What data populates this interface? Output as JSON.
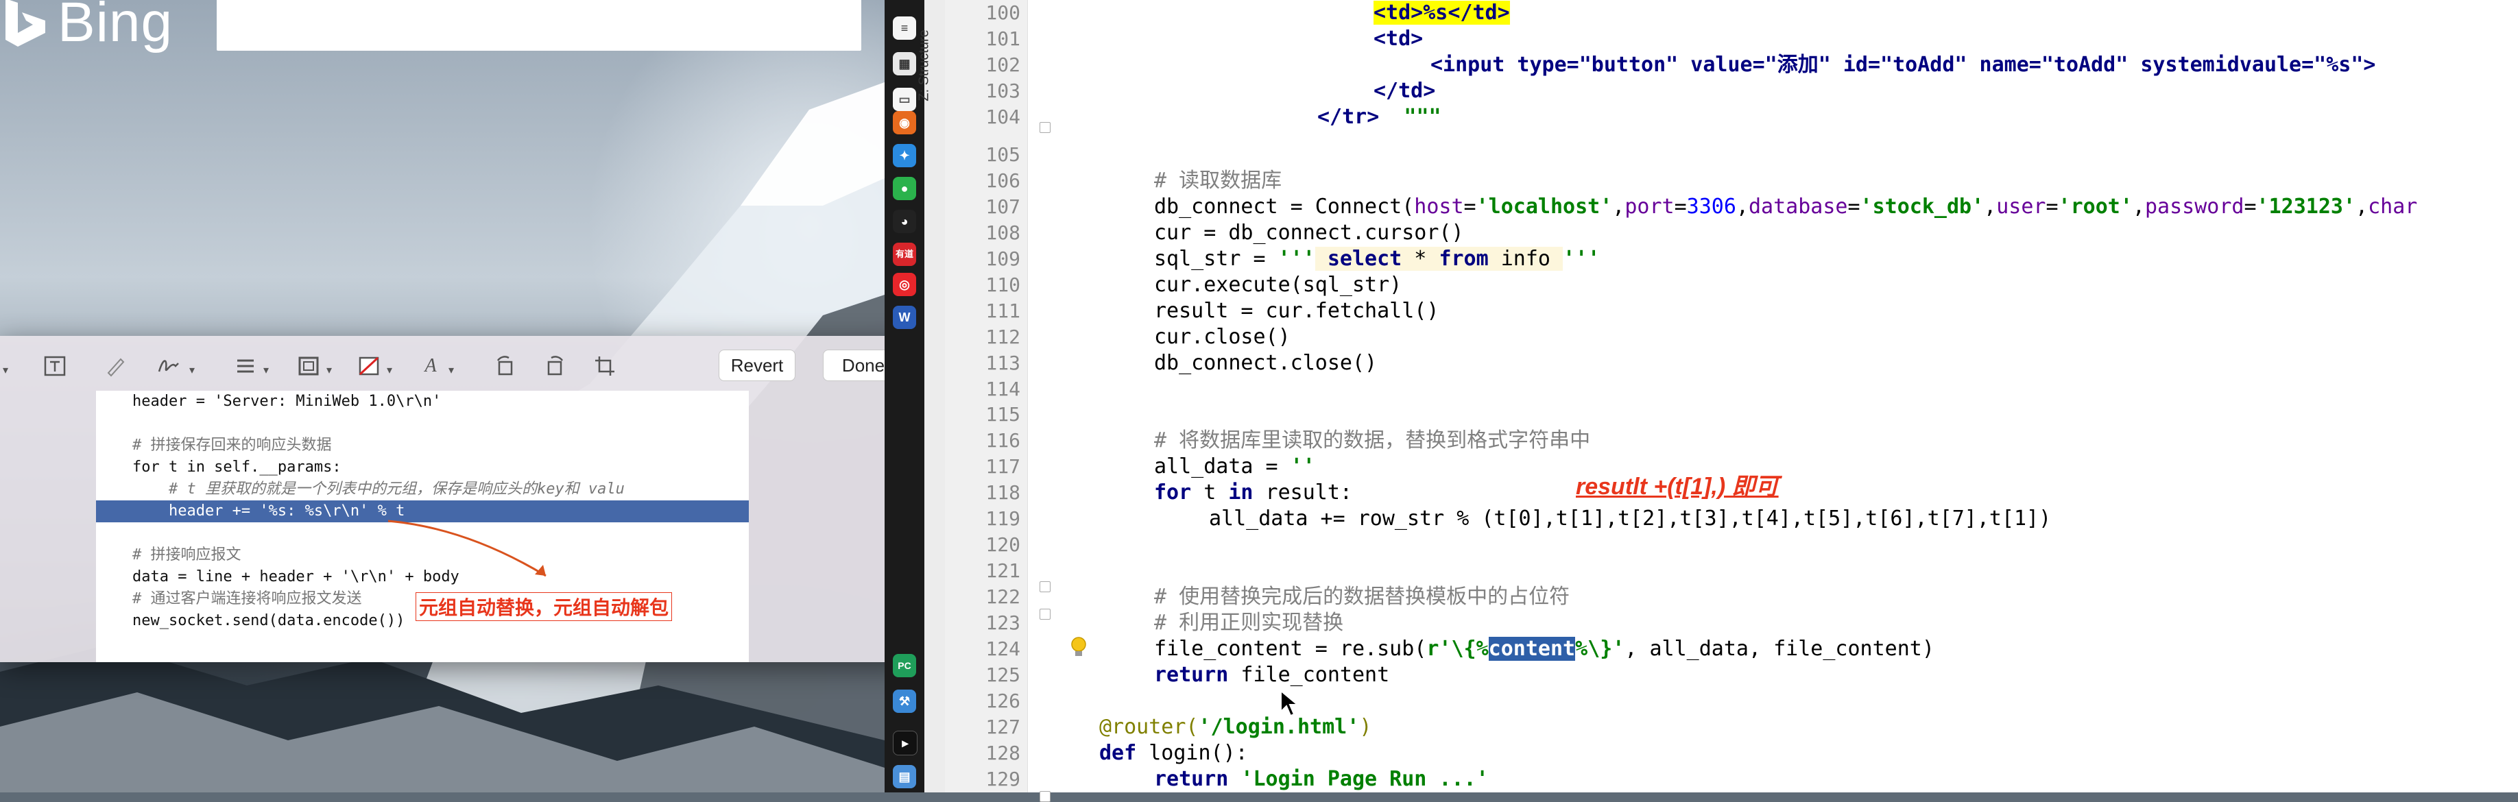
{
  "desktop": {
    "bing_logo_text": "Bing"
  },
  "preview_window": {
    "toolbar": {
      "revert_label": "Revert",
      "done_label": "Done",
      "text_tool_icon": "text-box-icon",
      "annotation_icons": [
        "sketch-icon",
        "signature-icon",
        "shape-style-icon",
        "border-color-icon",
        "fill-color-icon",
        "font-icon",
        "rotate-left-icon",
        "rotate-right-icon",
        "crop-icon",
        "trash-icon",
        "share-icon"
      ]
    },
    "document_lines": [
      "    header = 'Server: MiniWeb 1.0\\r\\n'",
      "",
      "    # 拼接保存回来的响应头数据",
      "    for t in self.__params:",
      "        # t 里获取的就是一个列表中的元组，保存是响应头的key和 valu",
      "        header += '%s: %s\\r\\n' % t",
      "",
      "    # 拼接响应报文",
      "    data = line + header + '\\r\\n' + body",
      "    # 通过客户端连接将响应报文发送",
      "    new_socket.send(data.encode())"
    ],
    "annotation_text": "元组自动替换，元组自动解包"
  },
  "ide": {
    "structure_tab_label": "Z: Structure",
    "line_numbers": [
      "100",
      "101",
      "102",
      "103",
      "104",
      "105",
      "106",
      "107",
      "108",
      "109",
      "110",
      "111",
      "112",
      "113",
      "114",
      "115",
      "116",
      "117",
      "118",
      "119",
      "120",
      "121",
      "122",
      "123",
      "124",
      "125",
      "126",
      "127",
      "128",
      "129"
    ],
    "code": {
      "l100": "<td>%s</td>",
      "l101": "<td>",
      "l102": "<input type=\"button\" value=\"添加\" id=\"toAdd\" name=\"toAdd\" systemidvaule=\"%s\">",
      "l103": "</td>",
      "l104a": "</tr>",
      "l104b": "  \"\"\"",
      "l106": "# 读取数据库",
      "l107a": "db_connect = Connect(",
      "l107_host_k": "host",
      "l107_host_v": "'localhost'",
      "l107_port_k": "port",
      "l107_port_v": "3306",
      "l107_db_k": "database",
      "l107_db_v": "'stock_db'",
      "l107_user_k": "user",
      "l107_user_v": "'root'",
      "l107_pw_k": "password",
      "l107_pw_v": "'123123'",
      "l107_char_k": "char",
      "l108": "cur = db_connect.cursor()",
      "l109a": "sql_str = ",
      "l109q1": "'''",
      "l109_select": " select",
      "l109_star": " * ",
      "l109_from": "from",
      "l109_info": " info ",
      "l109q2": "'''",
      "l110": "cur.execute(sql_str)",
      "l111": "result = cur.fetchall()",
      "l112": "cur.close()",
      "l113": "db_connect.close()",
      "l116": "# 将数据库里读取的数据，替换到格式字符串中",
      "l117a": "all_data = ",
      "l117b": "''",
      "l118_for": "for",
      "l118_t": " t ",
      "l118_in": "in",
      "l118_rest": " result:",
      "l119": "all_data += row_str % (t[0],t[1],t[2],t[3],t[4],t[5],t[6],t[7],t[1])",
      "l122": "# 使用替换完成后的数据替换模板中的占位符",
      "l123": "# 利用正则实现替换",
      "l124a": "file_content = re.sub(",
      "l124b": "r'\\{%",
      "l124c": "content",
      "l124d": "%\\}'",
      "l124e": ", all_data, file_content)",
      "l125_kw": "return",
      "l125_rest": " file_content",
      "l127a": "@router(",
      "l127b": "'/login.html'",
      "l127c": ")",
      "l128_kw": "def",
      "l128_rest": " login():",
      "l129_kw": "return",
      "l129_str": " 'Login Page Run ...'"
    },
    "annotation_text": "resutlt +(t[1],) 即可"
  },
  "dock": {
    "icons": [
      "notes-icon",
      "app-icon",
      "firefox-icon",
      "safari-icon",
      "wechat-icon",
      "qq-icon",
      "netease-music-icon",
      "weibo-icon",
      "word-icon",
      "pycharm-icon",
      "xcode-icon",
      "terminal-icon"
    ]
  }
}
